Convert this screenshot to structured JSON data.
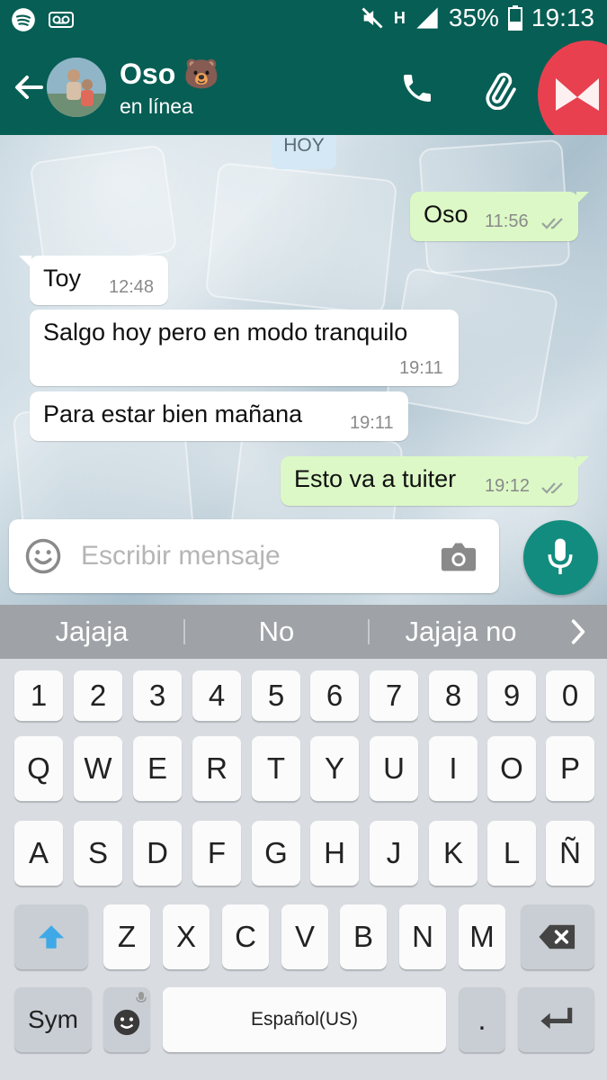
{
  "status_bar": {
    "battery": "35%",
    "time": "19:13",
    "network": "H",
    "icons": [
      "spotify-icon",
      "voicemail-icon",
      "mute-icon",
      "signal-icon",
      "battery-icon"
    ]
  },
  "header": {
    "contact_name": "Oso 🐻",
    "contact_status": "en línea",
    "icons": [
      "back-arrow-icon",
      "phone-icon",
      "paperclip-icon"
    ]
  },
  "chat": {
    "date_label": "HOY",
    "messages": [
      {
        "direction": "out",
        "text": "Oso",
        "time": "11:56",
        "read": true
      },
      {
        "direction": "in",
        "text": "Toy",
        "time": "12:48"
      },
      {
        "direction": "in",
        "text": "Salgo hoy pero en modo tranquilo",
        "time": "19:11"
      },
      {
        "direction": "in",
        "text": "Para estar bien mañana",
        "time": "19:11"
      },
      {
        "direction": "out",
        "text": "Esto va a tuiter",
        "time": "19:12",
        "read": true
      }
    ]
  },
  "composer": {
    "placeholder": "Escribir mensaje",
    "value": ""
  },
  "suggestions": [
    "Jajaja",
    "No",
    "Jajaja no"
  ],
  "keyboard": {
    "row_numbers": [
      "1",
      "2",
      "3",
      "4",
      "5",
      "6",
      "7",
      "8",
      "9",
      "0"
    ],
    "row_1": [
      "Q",
      "W",
      "E",
      "R",
      "T",
      "Y",
      "U",
      "I",
      "O",
      "P"
    ],
    "row_2": [
      "A",
      "S",
      "D",
      "F",
      "G",
      "H",
      "J",
      "K",
      "L",
      "Ñ"
    ],
    "row_3": [
      "Z",
      "X",
      "C",
      "V",
      "B",
      "N",
      "M"
    ],
    "sym_label": "Sym",
    "space_label": "Español(US)",
    "period_label": "."
  },
  "colors": {
    "header": "#075e54",
    "outgoing_bubble": "#dcf8c6",
    "incoming_bubble": "#ffffff",
    "mic_button": "#128c7e",
    "read_ticks": "#4fc3f7"
  }
}
